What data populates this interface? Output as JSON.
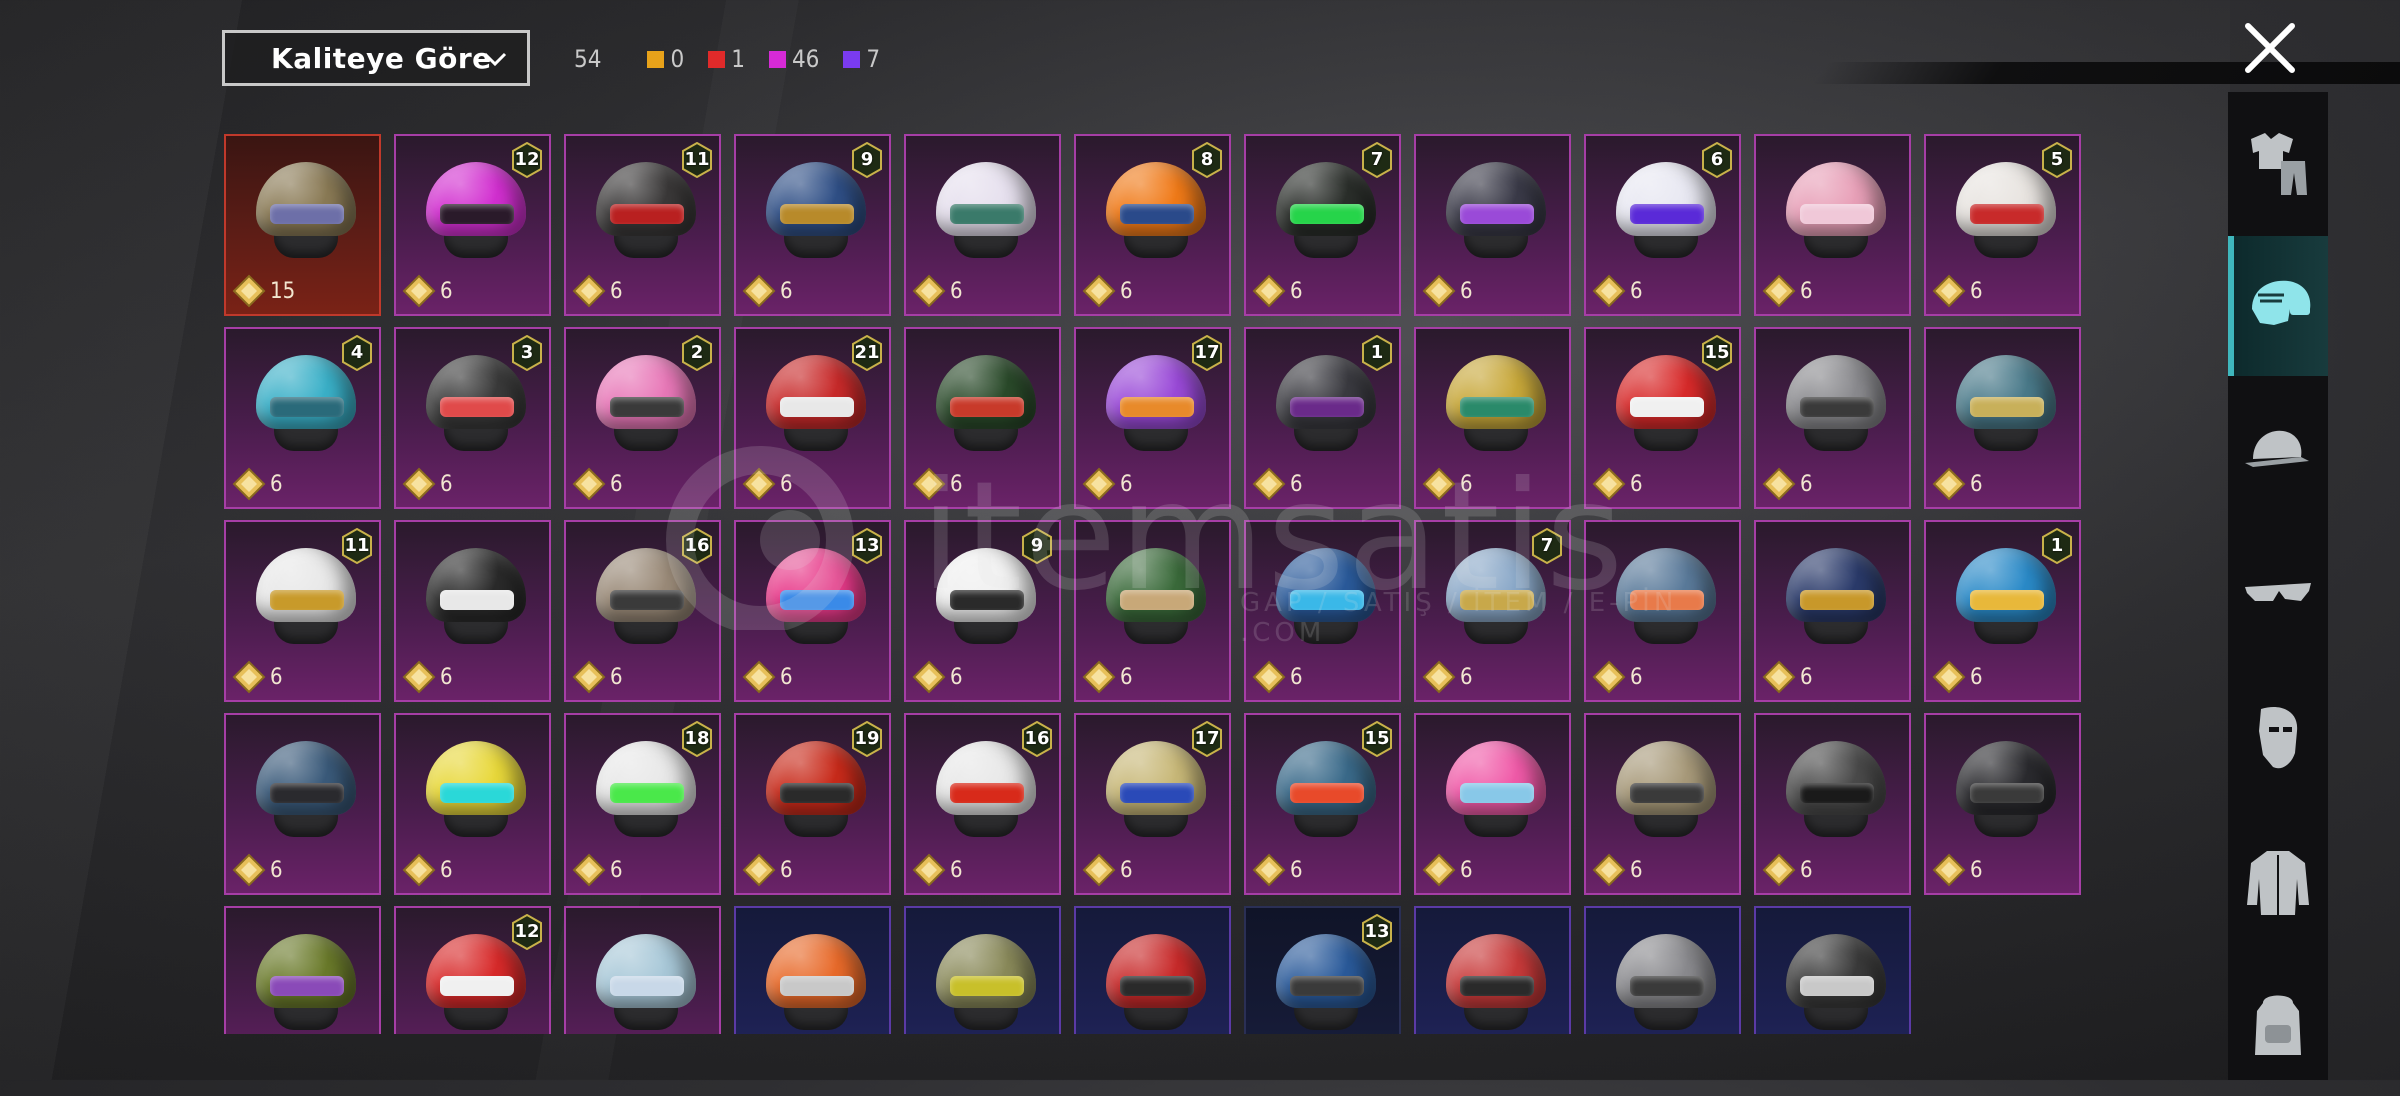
{
  "header": {
    "sort_label": "Kaliteye Göre",
    "total_count": "54",
    "quality_counts": [
      {
        "color": "#e8a21a",
        "value": "0"
      },
      {
        "color": "#e02a2a",
        "value": "1"
      },
      {
        "color": "#d62ad6",
        "value": "46"
      },
      {
        "color": "#7a3bf0",
        "value": "7"
      }
    ]
  },
  "watermark": {
    "text": "itemsatis",
    "sub": "GAP / SATIŞ / İTEM / E-PİN .COM"
  },
  "sidebar": {
    "items": [
      {
        "icon": "outfit-icon"
      },
      {
        "icon": "helmet-icon",
        "active": true
      },
      {
        "icon": "cap-icon"
      },
      {
        "icon": "glasses-icon"
      },
      {
        "icon": "mask-icon"
      },
      {
        "icon": "jacket-icon"
      },
      {
        "icon": "backpack-icon"
      }
    ]
  },
  "grid": {
    "items": [
      {
        "cost": "15",
        "badge": "",
        "rarity": "legend",
        "shell": "#8a7a55",
        "visor": "#6d6fa8"
      },
      {
        "cost": "6",
        "badge": "12",
        "shell": "#d22fd0",
        "visor": "#2a1a2a"
      },
      {
        "cost": "6",
        "badge": "11",
        "shell": "#3a3838",
        "visor": "#b92020"
      },
      {
        "cost": "6",
        "badge": "9",
        "shell": "#2f4f86",
        "visor": "#b88a2a"
      },
      {
        "cost": "6",
        "badge": "",
        "shell": "#e6e0ee",
        "visor": "#3a7a6a"
      },
      {
        "cost": "6",
        "badge": "8",
        "shell": "#f07a18",
        "visor": "#2a4a8a"
      },
      {
        "cost": "6",
        "badge": "7",
        "shell": "#2a2e2a",
        "visor": "#26d44a"
      },
      {
        "cost": "6",
        "badge": "",
        "shell": "#3a3a48",
        "visor": "#9a4ad8"
      },
      {
        "cost": "6",
        "badge": "6",
        "shell": "#e8e8f2",
        "visor": "#5a2ad8"
      },
      {
        "cost": "6",
        "badge": "",
        "shell": "#e8a0b8",
        "visor": "#f0c8d8"
      },
      {
        "cost": "6",
        "badge": "5",
        "shell": "#e8e4e0",
        "visor": "#c82a2a"
      },
      {
        "cost": "6",
        "badge": "4",
        "shell": "#3ab0c8",
        "visor": "#2a6a7a"
      },
      {
        "cost": "6",
        "badge": "3",
        "shell": "#3a3a3a",
        "visor": "#e04a4a"
      },
      {
        "cost": "6",
        "badge": "2",
        "shell": "#e878b8",
        "visor": "#3a3a3a"
      },
      {
        "cost": "6",
        "badge": "21",
        "shell": "#c82a2a",
        "visor": "#e8e8e8"
      },
      {
        "cost": "6",
        "badge": "",
        "shell": "#2a4a2a",
        "visor": "#c83a2a"
      },
      {
        "cost": "6",
        "badge": "17",
        "shell": "#9a4ad8",
        "visor": "#e88a2a"
      },
      {
        "cost": "6",
        "badge": "1",
        "shell": "#3a3a40",
        "visor": "#6a2a8a"
      },
      {
        "cost": "6",
        "badge": "",
        "shell": "#c8a83a",
        "visor": "#2a8a6a"
      },
      {
        "cost": "6",
        "badge": "15",
        "shell": "#d82a2a",
        "visor": "#f0f0f0"
      },
      {
        "cost": "6",
        "badge": "",
        "shell": "#8a8a8e",
        "visor": "#3a3a3a"
      },
      {
        "cost": "6",
        "badge": "",
        "shell": "#4a7a8a",
        "visor": "#c8b05a"
      },
      {
        "cost": "6",
        "badge": "11",
        "shell": "#e8e8e8",
        "visor": "#c89a2a"
      },
      {
        "cost": "6",
        "badge": "",
        "shell": "#2a2a2a",
        "visor": "#e8e8e8"
      },
      {
        "cost": "6",
        "badge": "16",
        "shell": "#9a8a78",
        "visor": "#3a3a3a"
      },
      {
        "cost": "6",
        "badge": "13",
        "shell": "#e83a8a",
        "visor": "#3a8ae8"
      },
      {
        "cost": "6",
        "badge": "9",
        "shell": "#f0f0f0",
        "visor": "#2a2a2a"
      },
      {
        "cost": "6",
        "badge": "",
        "shell": "#3a6a3a",
        "visor": "#c8a878"
      },
      {
        "cost": "6",
        "badge": "",
        "shell": "#2a5a9a",
        "visor": "#3ab8e8"
      },
      {
        "cost": "6",
        "badge": "7",
        "shell": "#8aa8c8",
        "visor": "#c8a84a"
      },
      {
        "cost": "6",
        "badge": "",
        "shell": "#5a7a9a",
        "visor": "#e87a4a"
      },
      {
        "cost": "6",
        "badge": "",
        "shell": "#2a3a6a",
        "visor": "#c8982a"
      },
      {
        "cost": "6",
        "badge": "1",
        "shell": "#2a8ac8",
        "visor": "#e8b83a"
      },
      {
        "cost": "6",
        "badge": "",
        "shell": "#3a5a7a",
        "visor": "#2a2a2e"
      },
      {
        "cost": "6",
        "badge": "",
        "shell": "#e8d83a",
        "visor": "#2ad8d8"
      },
      {
        "cost": "6",
        "badge": "18",
        "shell": "#e8e8e8",
        "visor": "#4ae84a"
      },
      {
        "cost": "6",
        "badge": "19",
        "shell": "#c82a1a",
        "visor": "#2a2a2a"
      },
      {
        "cost": "6",
        "badge": "16",
        "shell": "#e8e8e8",
        "visor": "#d82a1a"
      },
      {
        "cost": "6",
        "badge": "17",
        "shell": "#c8b878",
        "visor": "#2a4ab8"
      },
      {
        "cost": "6",
        "badge": "15",
        "shell": "#3a6a8a",
        "visor": "#e84a2a"
      },
      {
        "cost": "6",
        "badge": "",
        "shell": "#f05aa8",
        "visor": "#88c8e8"
      },
      {
        "cost": "6",
        "badge": "",
        "shell": "#a89a7a",
        "visor": "#3a3a3a"
      },
      {
        "cost": "6",
        "badge": "",
        "shell": "#4a4a4a",
        "visor": "#1a1a1a"
      },
      {
        "cost": "6",
        "badge": "",
        "shell": "#2a2a2e",
        "visor": "#3a3a3a"
      },
      {
        "cost": "",
        "badge": "",
        "shell": "#6a7a2a",
        "visor": "#8a4ab8"
      },
      {
        "cost": "",
        "badge": "12",
        "shell": "#d82a2a",
        "visor": "#f0f0f0"
      },
      {
        "cost": "",
        "badge": "",
        "shell": "#a8c8d8",
        "visor": "#c8d8e8"
      },
      {
        "cost": "",
        "badge": "",
        "rarity": "epic",
        "shell": "#e86a2a",
        "visor": "#c8c8c8"
      },
      {
        "cost": "",
        "badge": "",
        "rarity": "epic",
        "shell": "#8a8a5a",
        "visor": "#c8c02a"
      },
      {
        "cost": "",
        "badge": "",
        "rarity": "epic",
        "shell": "#c82a2a",
        "visor": "#2a2a2a"
      },
      {
        "cost": "",
        "badge": "13",
        "rarity": "dark",
        "shell": "#2a5a9a",
        "visor": "#3a3a3a"
      },
      {
        "cost": "",
        "badge": "",
        "rarity": "epic",
        "shell": "#c83a3a",
        "visor": "#2a2a2a"
      },
      {
        "cost": "",
        "badge": "",
        "rarity": "epic",
        "shell": "#8a8a8e",
        "visor": "#3a3a3a"
      },
      {
        "cost": "",
        "badge": "",
        "rarity": "epic",
        "shell": "#3a3a3a",
        "visor": "#c8c8c8"
      }
    ]
  },
  "colors": {
    "card_border": "#a63ea6",
    "badge_fill": "#1e2a14",
    "badge_stroke": "#c8b24a",
    "coin": "#e7c05a",
    "sidebar_active": "#3fb7bd"
  }
}
